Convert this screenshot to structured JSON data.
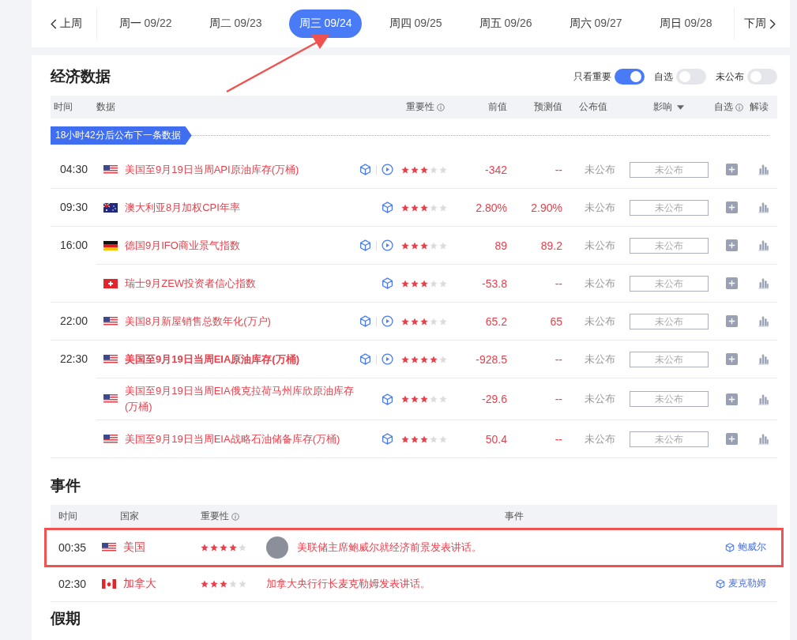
{
  "week_nav": {
    "prev": "上周",
    "next": "下周",
    "days": [
      {
        "label": "周一",
        "date": "09/22",
        "selected": false
      },
      {
        "label": "周二",
        "date": "09/23",
        "selected": false
      },
      {
        "label": "周三",
        "date": "09/24",
        "selected": true
      },
      {
        "label": "周四",
        "date": "09/25",
        "selected": false
      },
      {
        "label": "周五",
        "date": "09/26",
        "selected": false
      },
      {
        "label": "周六",
        "date": "09/27",
        "selected": false
      },
      {
        "label": "周日",
        "date": "09/28",
        "selected": false
      }
    ]
  },
  "economic_data": {
    "title": "经济数据",
    "toggles": [
      {
        "label": "只看重要",
        "on": true
      },
      {
        "label": "自选",
        "on": false
      },
      {
        "label": "未公布",
        "on": false
      }
    ],
    "columns": [
      "时间",
      "数据",
      "重要性",
      "前值",
      "预测值",
      "公布值",
      "影响",
      "自选",
      "解读"
    ],
    "countdown": "18小时42分后公布下一条数据",
    "rows": [
      {
        "time": "04:30",
        "flag": {
          "kind": "us"
        },
        "title": "美国至9月19日当周API原油库存(万桶)",
        "bold": false,
        "video": true,
        "stars": 3,
        "previous": "-342",
        "forecast": "--",
        "actual": "未公布",
        "impact_placeholder": "未公布"
      },
      {
        "time": "09:30",
        "flag": {
          "kind": "au"
        },
        "title": "澳大利亚8月加权CPI年率",
        "bold": false,
        "video": false,
        "stars": 3,
        "previous": "2.80%",
        "forecast": "2.90%",
        "actual": "未公布",
        "impact_placeholder": "未公布"
      },
      {
        "time": "16:00",
        "flag": {
          "kind": "de"
        },
        "title": "德国9月IFO商业景气指数",
        "bold": false,
        "video": true,
        "stars": 3,
        "previous": "89",
        "forecast": "89.2",
        "actual": "未公布",
        "impact_placeholder": "未公布"
      },
      {
        "flag": {
          "kind": "ch"
        },
        "title": "瑞士9月ZEW投资者信心指数",
        "bold": false,
        "video": false,
        "stars": 3,
        "previous": "-53.8",
        "forecast": "--",
        "actual": "未公布",
        "impact_placeholder": "未公布"
      },
      {
        "time": "22:00",
        "flag": {
          "kind": "us"
        },
        "title": "美国8月新屋销售总数年化(万户)",
        "bold": false,
        "video": true,
        "stars": 3,
        "previous": "65.2",
        "forecast": "65",
        "actual": "未公布",
        "impact_placeholder": "未公布"
      },
      {
        "time": "22:30",
        "flag": {
          "kind": "us"
        },
        "title": "美国至9月19日当周EIA原油库存(万桶)",
        "bold": true,
        "video": true,
        "stars": 4,
        "previous": "-928.5",
        "forecast": "--",
        "actual": "未公布",
        "impact_placeholder": "未公布"
      },
      {
        "flag": {
          "kind": "us"
        },
        "title": "美国至9月19日当周EIA俄克拉荷马州库欣原油库存(万桶)",
        "bold": false,
        "video": false,
        "stars": 3,
        "previous": "-29.6",
        "forecast": "--",
        "actual": "未公布",
        "impact_placeholder": "未公布"
      },
      {
        "flag": {
          "kind": "us"
        },
        "title": "美国至9月19日当周EIA战略石油储备库存(万桶)",
        "bold": false,
        "video": false,
        "stars": 3,
        "previous": "50.4",
        "forecast": "--",
        "actual": "未公布",
        "impact_placeholder": "未公布"
      }
    ]
  },
  "events": {
    "title": "事件",
    "columns": [
      "时间",
      "国家",
      "重要性",
      "事件"
    ],
    "rows": [
      {
        "time": "00:35",
        "flag": {
          "kind": "us"
        },
        "country": "美国",
        "stars": 4,
        "avatar": true,
        "title": "美联储主席鲍威尔就经济前景发表讲话。",
        "tag": "鲍威尔",
        "highlighted": true
      },
      {
        "time": "02:30",
        "flag": {
          "kind": "ca"
        },
        "country": "加拿大",
        "stars": 3,
        "avatar": false,
        "title": "加拿大央行行长麦克勒姆发表讲话。",
        "tag": "麦克勒姆",
        "highlighted": false
      }
    ]
  },
  "holidays": {
    "title": "假期"
  }
}
